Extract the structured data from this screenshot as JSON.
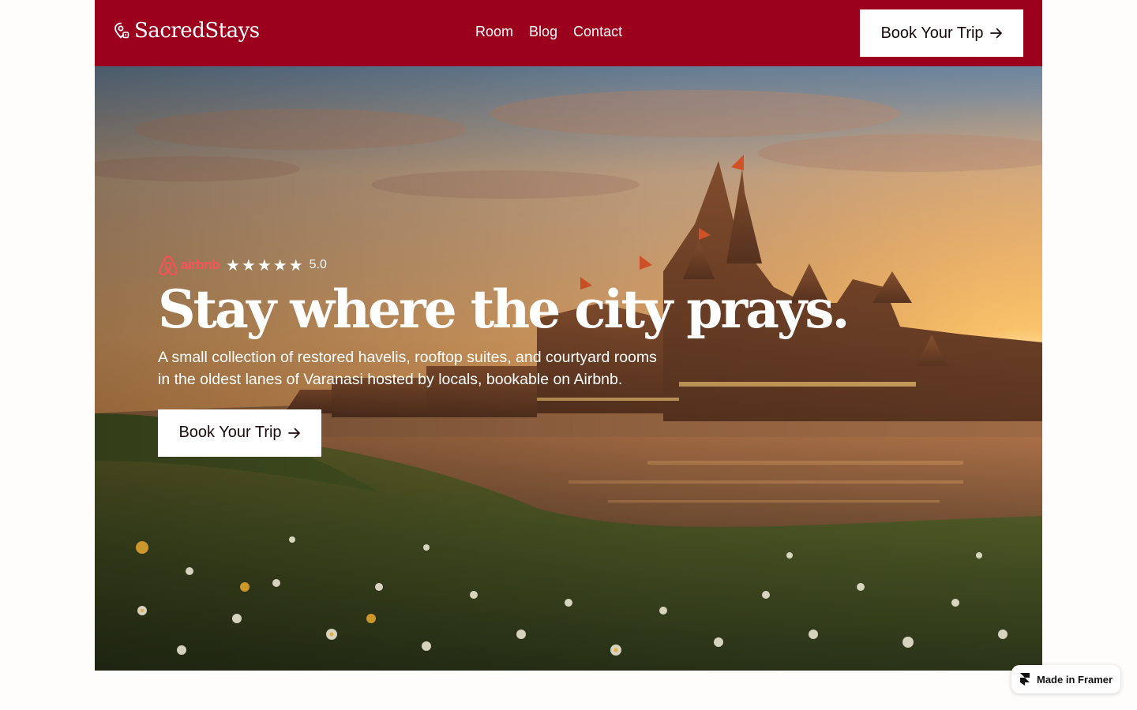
{
  "brand": {
    "name": "SacredStays",
    "icon": "location-pin-icon"
  },
  "nav": {
    "links": [
      "Room",
      "Blog",
      "Contact"
    ]
  },
  "header_cta": {
    "label": "Book Your Trip",
    "icon": "arrow-right-icon"
  },
  "hero": {
    "airbnb_logo_text": "airbnb",
    "stars": [
      "★",
      "★",
      "★",
      "★",
      "★"
    ],
    "rating": "5.0",
    "headline": "Stay where the city prays.",
    "subtext": "A small collection of restored havelis, rooftop suites, and courtyard rooms in the oldest lanes of Varanasi hosted by locals, bookable on Airbnb.",
    "cta_label": "Book Your Trip",
    "cta_icon": "arrow-right-icon"
  },
  "badge": {
    "label": "Made in Framer",
    "icon": "framer-logo-icon"
  },
  "colors": {
    "brand_red": "#9b001c",
    "airbnb_red": "#ff4f58",
    "white": "#ffffff"
  }
}
